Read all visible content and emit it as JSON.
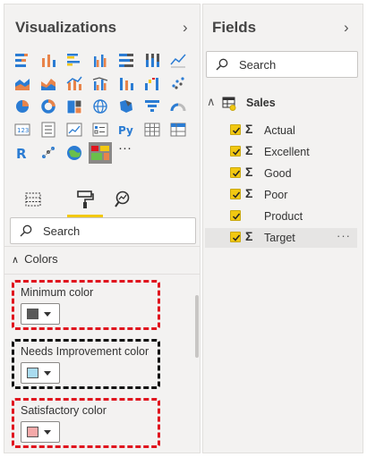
{
  "visualizations": {
    "title": "Visualizations",
    "format_tabs": [
      "fields-wells",
      "format-paintroller",
      "analytics"
    ],
    "search_placeholder": "Search",
    "colors_section": "Colors",
    "color_settings": [
      {
        "label": "Minimum color",
        "swatch": "#595959"
      },
      {
        "label": "Needs Improvement color",
        "swatch": "#a9dbef"
      },
      {
        "label": "Satisfactory color",
        "swatch": "#f4a9a9"
      }
    ],
    "more_visuals": "···"
  },
  "fields": {
    "title": "Fields",
    "search_placeholder": "Search",
    "table": {
      "name": "Sales",
      "items": [
        {
          "name": "Actual",
          "checked": true,
          "sigma": "Σ"
        },
        {
          "name": "Excellent",
          "checked": true,
          "sigma": "Σ"
        },
        {
          "name": "Good",
          "checked": true,
          "sigma": "Σ"
        },
        {
          "name": "Poor",
          "checked": true,
          "sigma": "Σ"
        },
        {
          "name": "Product",
          "checked": true,
          "sigma": ""
        },
        {
          "name": "Target",
          "checked": true,
          "sigma": "Σ",
          "more": "···"
        }
      ]
    }
  },
  "colors": {
    "accent_yellow": "#f2c811",
    "highlight_red": "#e0141e",
    "highlight_black": "#111111"
  }
}
